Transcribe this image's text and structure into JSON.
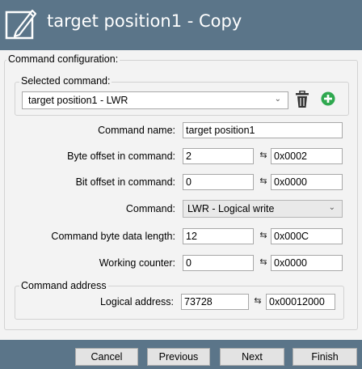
{
  "header": {
    "title": "target position1 - Copy",
    "icon": "edit-pencil-icon"
  },
  "command_configuration": {
    "legend": "Command configuration:",
    "selected_command": {
      "legend": "Selected command:",
      "value": "target position1 - LWR",
      "delete_icon": "trash-icon",
      "add_icon": "add-circle-icon"
    }
  },
  "fields": {
    "command_name": {
      "label": "Command name:",
      "value": "target position1"
    },
    "byte_offset": {
      "label": "Byte offset in command:",
      "value": "2",
      "hex": "0x0002"
    },
    "bit_offset": {
      "label": "Bit offset in command:",
      "value": "0",
      "hex": "0x0000"
    },
    "command": {
      "label": "Command:",
      "value": "LWR - Logical write"
    },
    "data_length": {
      "label": "Command byte data length:",
      "value": "12",
      "hex": "0x000C"
    },
    "working_counter": {
      "label": "Working counter:",
      "value": "0",
      "hex": "0x0000"
    }
  },
  "command_address": {
    "legend": "Command address",
    "logical_address": {
      "label": "Logical address:",
      "value": "73728",
      "hex": "0x00012000"
    }
  },
  "footer": {
    "cancel": "Cancel",
    "previous": "Previous",
    "next": "Next",
    "finish": "Finish"
  },
  "colors": {
    "header_bg": "#5b7589",
    "add_green": "#2fa84f",
    "panel_bg": "#f3f3f3"
  }
}
